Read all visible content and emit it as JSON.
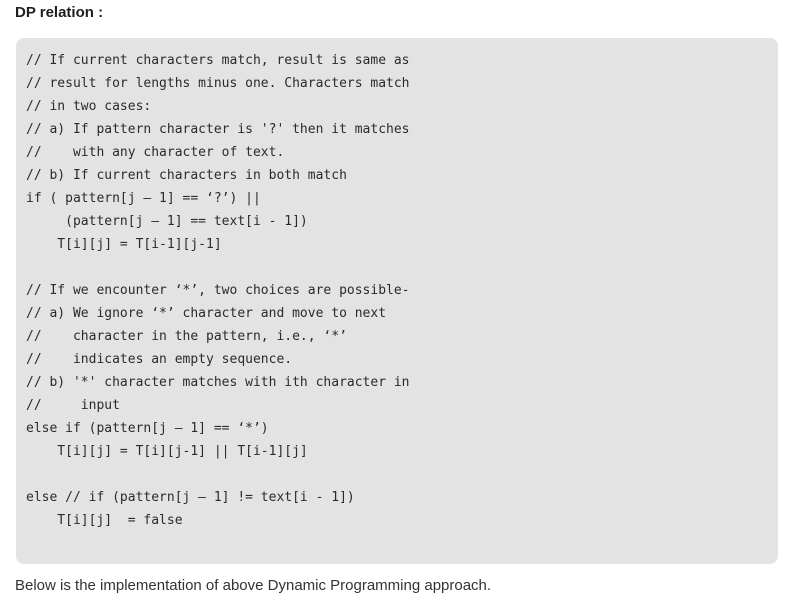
{
  "heading": "DP relation :",
  "code_lines": [
    "// If current characters match, result is same as",
    "// result for lengths minus one. Characters match",
    "// in two cases:",
    "// a) If pattern character is '?' then it matches",
    "//    with any character of text.",
    "// b) If current characters in both match",
    "if ( pattern[j – 1] == ‘?’) ||",
    "     (pattern[j – 1] == text[i - 1])",
    "    T[i][j] = T[i-1][j-1]",
    "",
    "// If we encounter ‘*’, two choices are possible-",
    "// a) We ignore ‘*’ character and move to next",
    "//    character in the pattern, i.e., ‘*’",
    "//    indicates an empty sequence.",
    "// b) '*' character matches with ith character in",
    "//     input",
    "else if (pattern[j – 1] == ‘*’)",
    "    T[i][j] = T[i][j-1] || T[i-1][j]",
    "",
    "else // if (pattern[j – 1] != text[i - 1])",
    "    T[i][j]  = false"
  ],
  "footer": "Below is the implementation of above Dynamic Programming approach."
}
